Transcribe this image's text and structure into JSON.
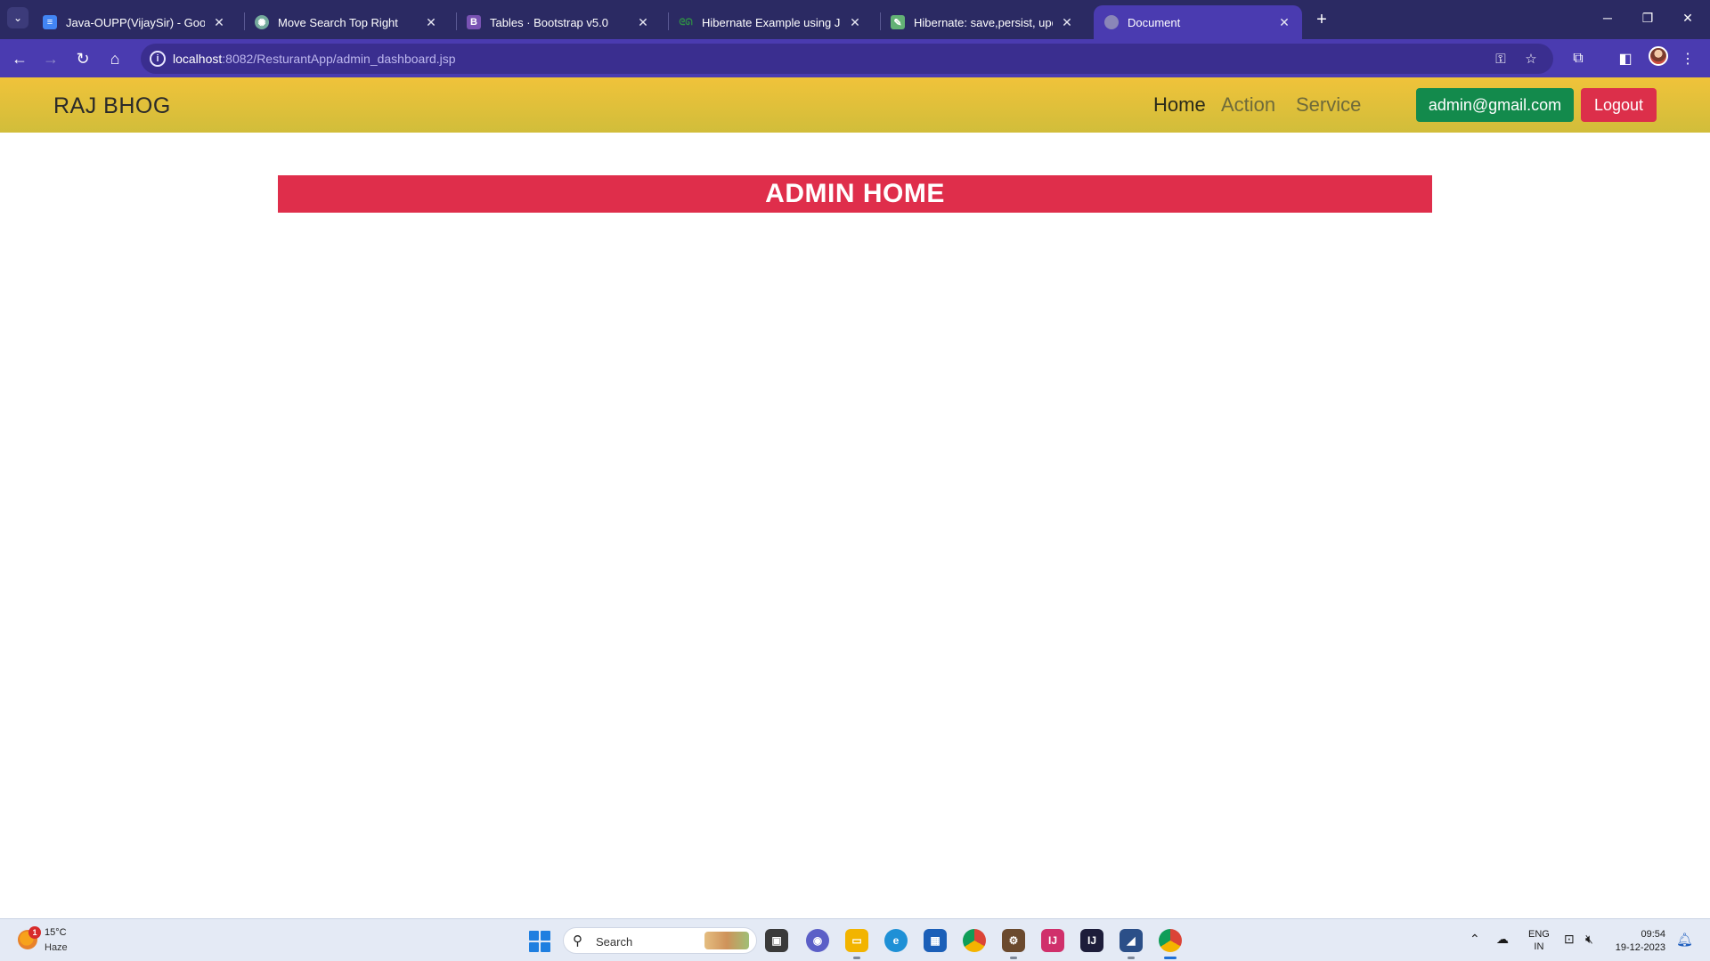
{
  "browser": {
    "tabs": [
      {
        "title": "Java-OUPP(VijaySir) - Google D",
        "favicon": "google-docs-icon",
        "color": "#4285f4"
      },
      {
        "title": "Move Search Top Right",
        "favicon": "chatgpt-icon",
        "color": "#74aa9c"
      },
      {
        "title": "Tables · Bootstrap v5.0",
        "favicon": "bootstrap-icon",
        "color": "#7952b3"
      },
      {
        "title": "Hibernate Example using JPA ar",
        "favicon": "geeksforgeeks-icon",
        "color": "#2f8d46"
      },
      {
        "title": "Hibernate: save,persist, update,",
        "favicon": "baeldung-icon",
        "color": "#63b175"
      },
      {
        "title": "Document",
        "favicon": "globe-icon",
        "color": "#8a86b8"
      }
    ],
    "address": {
      "host": "localhost",
      "path": ":8082/ResturantApp/admin_dashboard.jsp"
    }
  },
  "site": {
    "brand": "RAJ BHOG",
    "nav": [
      "Home",
      "Action",
      "Service"
    ],
    "email_button": "admin@gmail.com",
    "logout_button": "Logout",
    "banner": "ADMIN HOME",
    "colors": {
      "navbar": "#f0c33a",
      "banner": "#df2e4b",
      "email_button": "#138a4c",
      "logout_button": "#dc2f4a"
    }
  },
  "taskbar": {
    "weather_temp": "15°C",
    "weather_desc": "Haze",
    "weather_badge": "1",
    "search_label": "Search",
    "lang_line1": "ENG",
    "lang_line2": "IN",
    "time": "09:54",
    "date": "19-12-2023"
  }
}
